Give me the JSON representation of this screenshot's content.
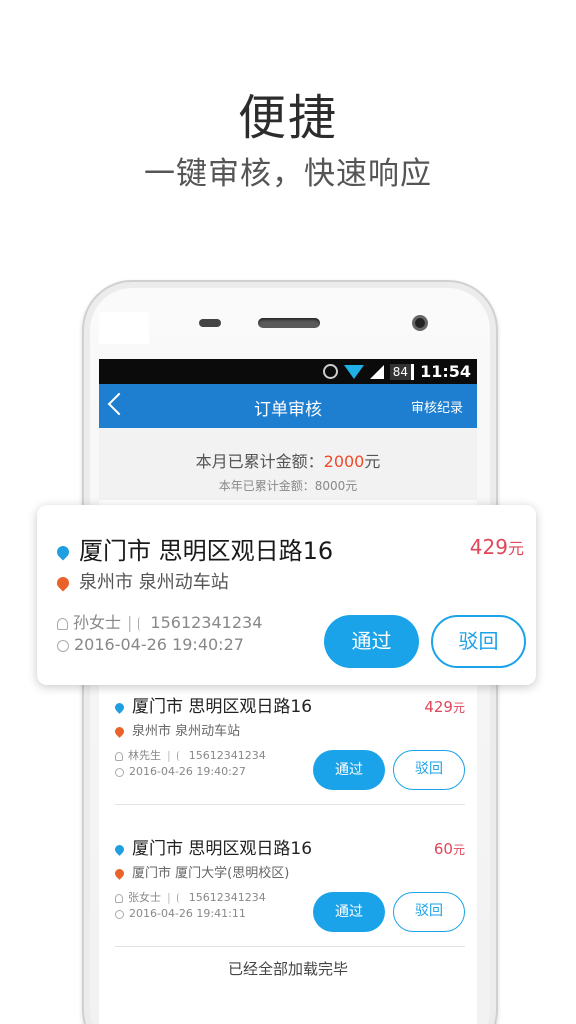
{
  "hero": {
    "title": "便捷",
    "subtitle": "一键审核，快速响应"
  },
  "status_bar": {
    "battery": "84",
    "time": "11:54"
  },
  "navbar": {
    "title": "订单审核",
    "right_label": "审核纪录"
  },
  "summary": {
    "month_prefix": "本月已累计金额：",
    "month_amount": "2000",
    "month_unit": "元",
    "year_text": "本年已累计金额：8000元"
  },
  "popup": {
    "from": "厦门市 思明区观日路16",
    "to": "泉州市 泉州动车站",
    "price": "429",
    "unit": "元",
    "contact_name": "孙女士",
    "phone": "15612341234",
    "time": "2016-04-26 19:40:27",
    "approve": "通过",
    "reject": "驳回"
  },
  "orders": [
    {
      "from": "厦门市 思明区观日路16",
      "to": "泉州市 泉州动车站",
      "price": "429",
      "unit": "元",
      "contact_name": "林先生",
      "phone": "15612341234",
      "time": "2016-04-26 19:40:27",
      "approve": "通过",
      "reject": "驳回"
    },
    {
      "from": "厦门市 思明区观日路16",
      "to": "厦门市 厦门大学(思明校区)",
      "price": "60",
      "unit": "元",
      "contact_name": "张女士",
      "phone": "15612341234",
      "time": "2016-04-26 19:41:11",
      "approve": "通过",
      "reject": "驳回"
    }
  ],
  "footer": "已经全部加载完毕",
  "icons": [
    "location-pin-icon",
    "origin-pin-icon",
    "person-icon",
    "phone-icon",
    "clock-icon",
    "back-arrow-icon",
    "alarm-icon",
    "wifi-icon",
    "signal-icon",
    "battery-icon"
  ],
  "colors": {
    "nav_blue": "#1e7ed0",
    "button_blue": "#1aa3e8",
    "price_red": "#e2465a",
    "amount_orange": "#ee4b29"
  }
}
